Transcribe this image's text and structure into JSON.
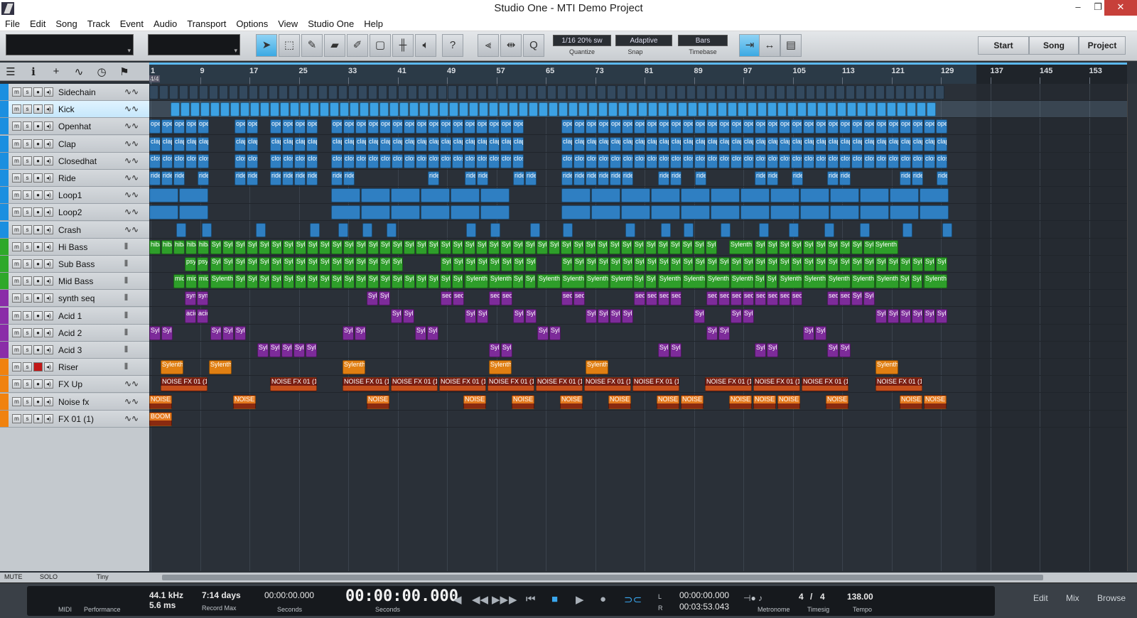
{
  "app": {
    "title": "Studio One - MTI Demo Project",
    "window_buttons": [
      "–",
      "❐",
      "✕"
    ]
  },
  "menu": [
    "File",
    "Edit",
    "Song",
    "Track",
    "Event",
    "Audio",
    "Transport",
    "Options",
    "View",
    "Studio One",
    "Help"
  ],
  "toolbar": {
    "quantize_value": "1/16 20% sw",
    "quantize_label": "Quantize",
    "snap_value": "Adaptive",
    "snap_label": "Snap",
    "timebase_value": "Bars",
    "timebase_label": "Timebase",
    "help_label": "?",
    "start_label": "Start",
    "song_label": "Song",
    "project_label": "Project"
  },
  "ruler": {
    "time_signature": "4/4",
    "bars": [
      "1",
      "9",
      "17",
      "25",
      "33",
      "41",
      "49",
      "57",
      "65",
      "73",
      "81",
      "89",
      "97",
      "105",
      "113",
      "121",
      "129",
      "137",
      "145",
      "153"
    ]
  },
  "tracks": [
    {
      "name": "Sidechain",
      "color": "#1b8fe0",
      "icon": "waveform-icon"
    },
    {
      "name": "Kick",
      "color": "#1b8fe0",
      "icon": "waveform-icon",
      "selected": true
    },
    {
      "name": "Openhat",
      "color": "#1b8fe0",
      "icon": "waveform-icon"
    },
    {
      "name": "Clap",
      "color": "#1b8fe0",
      "icon": "waveform-icon"
    },
    {
      "name": "Closedhat",
      "color": "#1b8fe0",
      "icon": "waveform-icon"
    },
    {
      "name": "Ride",
      "color": "#1b8fe0",
      "icon": "waveform-icon"
    },
    {
      "name": "Loop1",
      "color": "#1b8fe0",
      "icon": "waveform-icon"
    },
    {
      "name": "Loop2",
      "color": "#1b8fe0",
      "icon": "waveform-icon"
    },
    {
      "name": "Crash",
      "color": "#1b8fe0",
      "icon": "waveform-icon"
    },
    {
      "name": "Hi Bass",
      "color": "#2ea82a",
      "icon": "keys-icon"
    },
    {
      "name": "Sub Bass",
      "color": "#2ea82a",
      "icon": "keys-icon"
    },
    {
      "name": "Mid Bass",
      "color": "#2ea82a",
      "icon": "keys-icon"
    },
    {
      "name": "synth seq",
      "color": "#8a2ca8",
      "icon": "keys-icon"
    },
    {
      "name": "Acid 1",
      "color": "#8a2ca8",
      "icon": "keys-icon"
    },
    {
      "name": "Acid 2",
      "color": "#8a2ca8",
      "icon": "keys-icon"
    },
    {
      "name": "Acid 3",
      "color": "#8a2ca8",
      "icon": "keys-icon"
    },
    {
      "name": "Riser",
      "color": "#f0820f",
      "icon": "keys-icon",
      "armed": true
    },
    {
      "name": "FX Up",
      "color": "#f0820f",
      "icon": "waveform-icon"
    },
    {
      "name": "Noise fx",
      "color": "#f0820f",
      "icon": "waveform-icon"
    },
    {
      "name": "FX 01 (1)",
      "color": "#f0820f",
      "icon": "waveform-icon"
    }
  ],
  "track_buttons": [
    "m",
    "s",
    "●",
    "◂)"
  ],
  "footer": {
    "mute_label": "MUTE",
    "solo_label": "SOLO",
    "size_label": "Tiny"
  },
  "clip_labels": {
    "openhat": "ope",
    "clap": "clap",
    "closedhat": "clos",
    "ride": "ride",
    "hibass": "hiba",
    "syl": "Syl",
    "sylenth": "Sylenth",
    "subbass": "psy",
    "midbass": "mid",
    "synthseq": "seq",
    "synth_first": "syn",
    "acid_first": "acid",
    "noisefx01": "NOISE FX 01 (1",
    "noise": "NOISE",
    "boom": "BOOM !"
  },
  "transport": {
    "midi_label": "MIDI",
    "performance_label": "Performance",
    "sample_rate": "44.1 kHz",
    "latency": "5.6 ms",
    "record_max_value": "7:14 days",
    "record_max_label": "Record Max",
    "seconds_small_value": "00:00:00.000",
    "seconds_small_label": "Seconds",
    "main_time": "00:00:00.000",
    "main_time_label": "Seconds",
    "loop_start": "00:00:00.000",
    "loop_end": "00:03:53.043",
    "loop_l": "L",
    "loop_r": "R",
    "metronome_label": "Metronome",
    "timesig_num": "4",
    "timesig_slash": "/",
    "timesig_den": "4",
    "timesig_label": "Timesig",
    "tempo_value": "138.00",
    "tempo_label": "Tempo",
    "edit_label": "Edit",
    "mix_label": "Mix",
    "browse_label": "Browse"
  }
}
